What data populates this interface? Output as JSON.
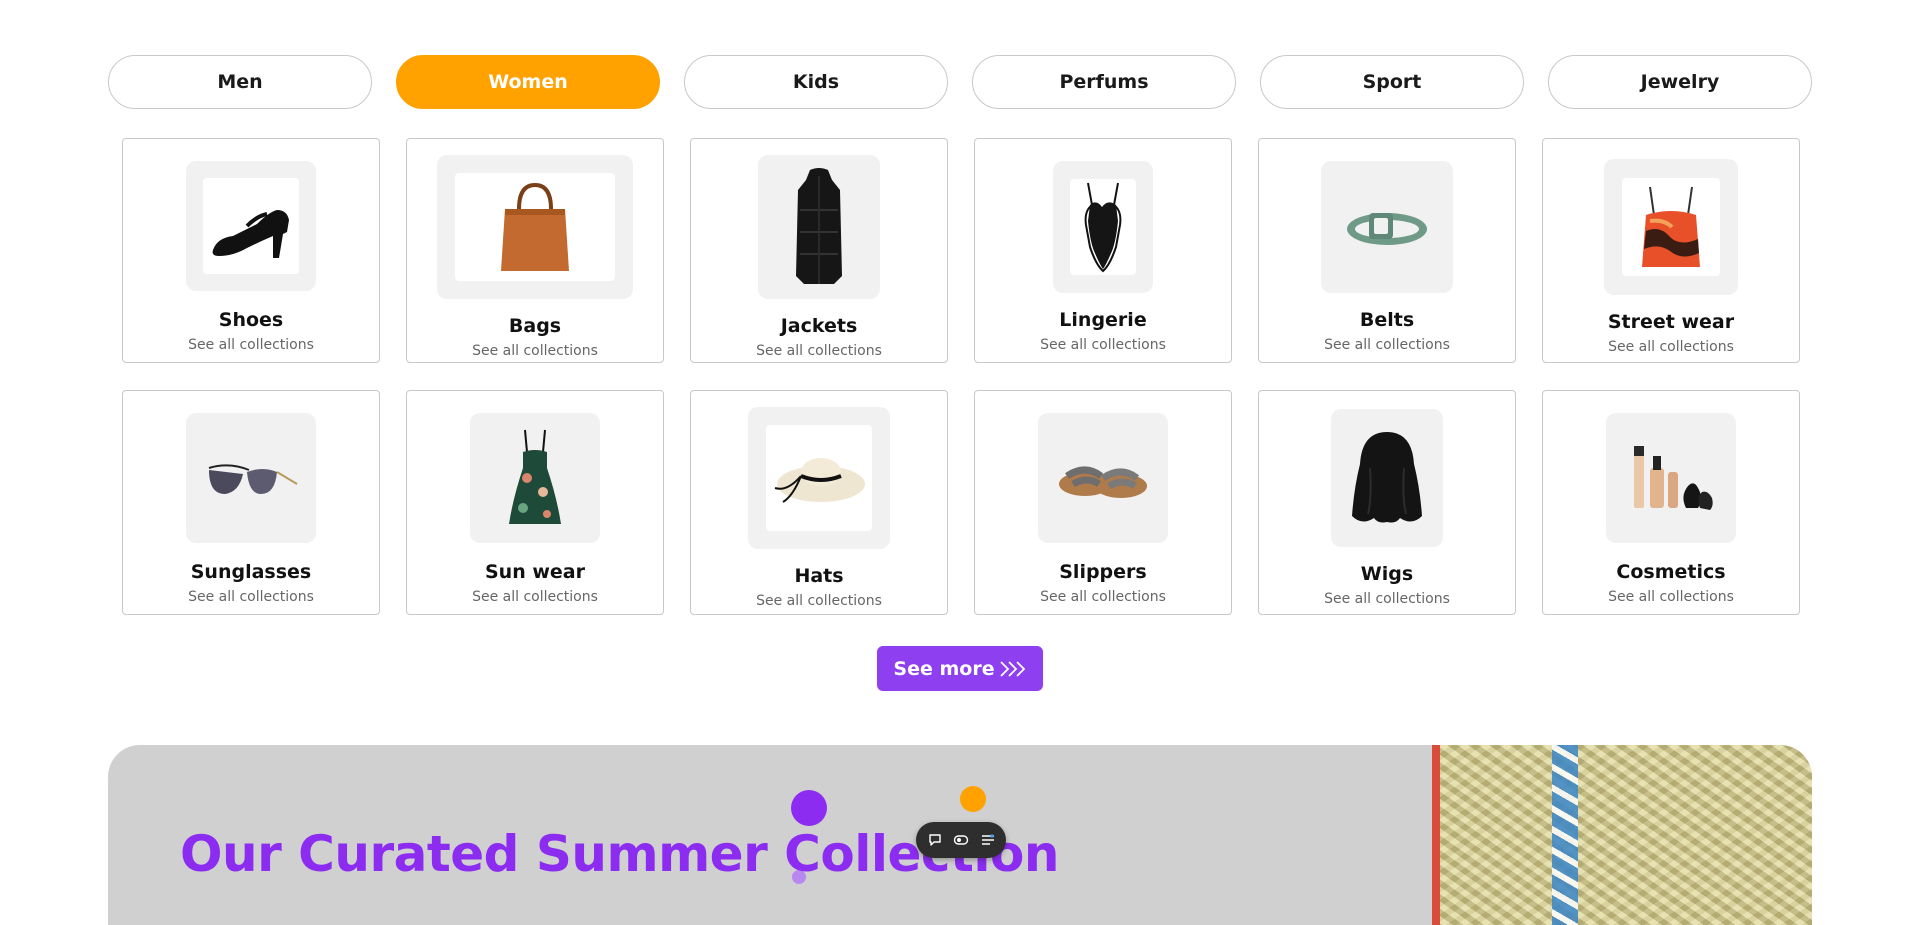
{
  "tabs": [
    {
      "label": "Men",
      "active": false
    },
    {
      "label": "Women",
      "active": true
    },
    {
      "label": "Kids",
      "active": false
    },
    {
      "label": "Perfums",
      "active": false
    },
    {
      "label": "Sport",
      "active": false
    },
    {
      "label": "Jewelry",
      "active": false
    }
  ],
  "categories": [
    {
      "title": "Shoes",
      "subtitle": "See all collections",
      "icon": "heel-shoe-icon"
    },
    {
      "title": "Bags",
      "subtitle": "See all collections",
      "icon": "handbag-icon"
    },
    {
      "title": "Jackets",
      "subtitle": "See all collections",
      "icon": "long-jacket-icon"
    },
    {
      "title": "Lingerie",
      "subtitle": "See all collections",
      "icon": "bodysuit-icon"
    },
    {
      "title": "Belts",
      "subtitle": "See all collections",
      "icon": "belt-icon"
    },
    {
      "title": "Street wear",
      "subtitle": "See all collections",
      "icon": "crop-top-icon"
    },
    {
      "title": "Sunglasses",
      "subtitle": "See all collections",
      "icon": "sunglasses-icon"
    },
    {
      "title": "Sun wear",
      "subtitle": "See all collections",
      "icon": "dress-icon"
    },
    {
      "title": "Hats",
      "subtitle": "See all collections",
      "icon": "sun-hat-icon"
    },
    {
      "title": "Slippers",
      "subtitle": "See all collections",
      "icon": "sandals-icon"
    },
    {
      "title": "Wigs",
      "subtitle": "See all collections",
      "icon": "wig-icon"
    },
    {
      "title": "Cosmetics",
      "subtitle": "See all collections",
      "icon": "cosmetics-icon"
    }
  ],
  "see_more": {
    "label": "See more",
    "icon": "triple-chevron-right-icon"
  },
  "banner": {
    "title": "Our Curated Summer Collection"
  },
  "float_toolbar": {
    "icons": [
      "comment-icon",
      "toggle-icon",
      "list-icon"
    ]
  },
  "colors": {
    "accent_orange": "#ffa200",
    "accent_purple": "#8e3ff0",
    "banner_title": "#8b2cf0",
    "banner_bg": "#d0d0d0"
  }
}
